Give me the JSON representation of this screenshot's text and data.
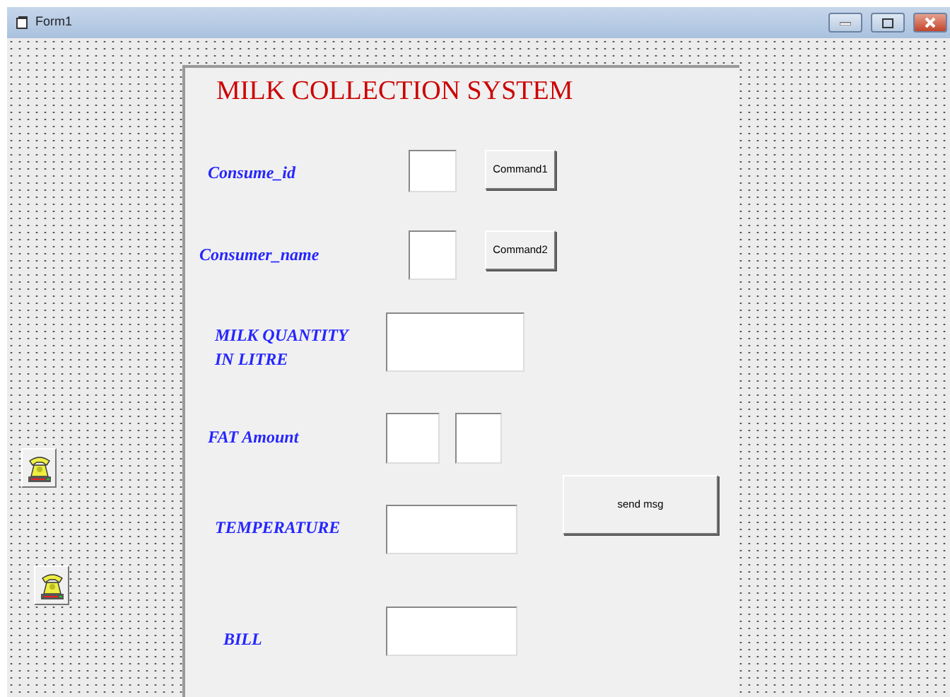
{
  "window": {
    "title": "Form1"
  },
  "heading": "MILK COLLECTION SYSTEM",
  "fields": [
    {
      "label": "Consume_id"
    },
    {
      "label": "Consumer_name"
    },
    {
      "label": "MILK QUANTITY IN LITRE"
    },
    {
      "label": "FAT Amount"
    },
    {
      "label": "TEMPERATURE"
    },
    {
      "label": "BILL"
    }
  ],
  "buttons": [
    {
      "label": "Command1"
    },
    {
      "label": "Command2"
    },
    {
      "label": "send msg"
    }
  ]
}
